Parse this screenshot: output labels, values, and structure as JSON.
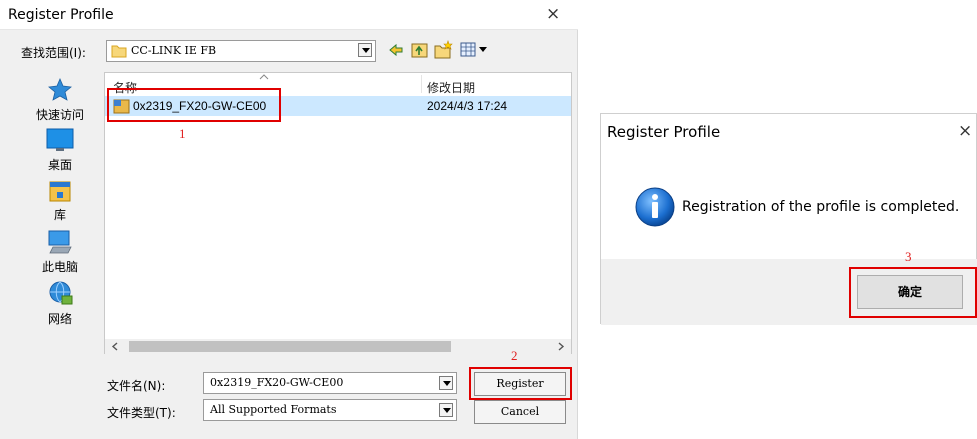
{
  "main_dialog": {
    "title": "Register Profile",
    "close_glyph": "×",
    "look_in_label": "查找范围(I):",
    "look_in_value": "CC-LINK IE FB",
    "toolbar_icons": [
      "back-arrow-icon",
      "up-folder-icon",
      "new-folder-icon",
      "view-menu-icon"
    ],
    "places": [
      {
        "label": "快速访问",
        "icon": "quick-access-star-icon"
      },
      {
        "label": "桌面",
        "icon": "desktop-icon"
      },
      {
        "label": "库",
        "icon": "library-icon"
      },
      {
        "label": "此电脑",
        "icon": "computer-icon"
      },
      {
        "label": "网络",
        "icon": "network-icon"
      }
    ],
    "columns": {
      "name": "名称",
      "modified": "修改日期"
    },
    "files": [
      {
        "name": "0x2319_FX20-GW-CE00",
        "modified": "2024/4/3 17:24",
        "selected": true
      }
    ],
    "filename_label": "文件名(N):",
    "filename_value": "0x2319_FX20-GW-CE00",
    "filetype_label": "文件类型(T):",
    "filetype_value": "All Supported Formats",
    "register_button": "Register",
    "cancel_button": "Cancel"
  },
  "annotations": {
    "step1": "1",
    "step2": "2",
    "step3": "3",
    "color": "#e00000"
  },
  "completion_dialog": {
    "title": "Register Profile",
    "close_glyph": "×",
    "icon": "info-icon",
    "message": "Registration of the profile is completed.",
    "ok_button": "确定"
  }
}
